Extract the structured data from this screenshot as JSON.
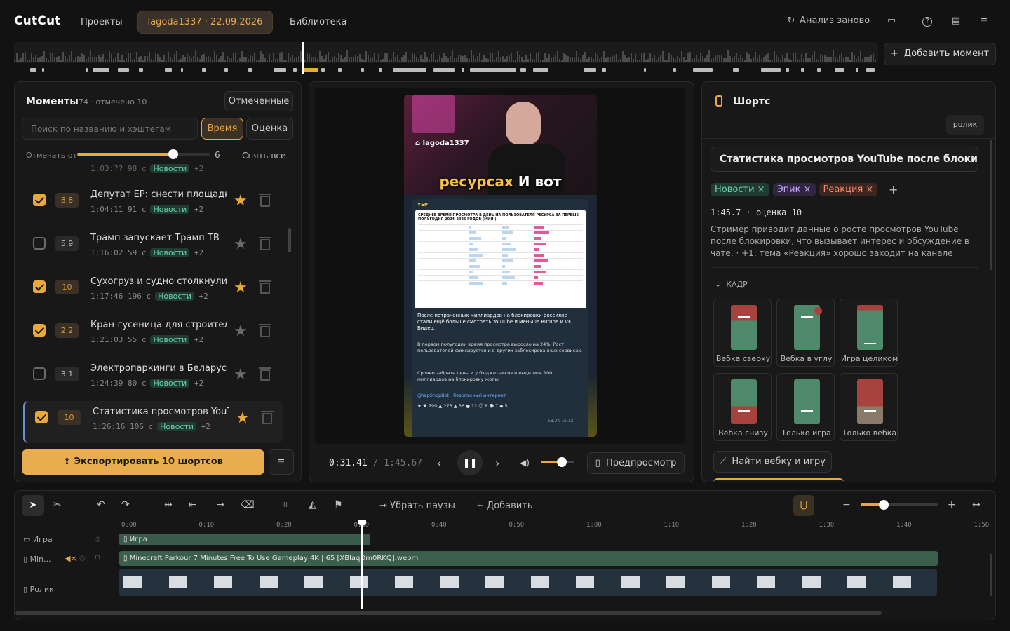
{
  "app": {
    "title": "CutCut"
  },
  "nav": {
    "projects": "Проекты",
    "active_tab": "lagoda1337 · 22.09.2026",
    "library": "Библиотека"
  },
  "toolbar": {
    "reanalyze": "Анализ заново",
    "add_moment": "Добавить момент"
  },
  "moments": {
    "title": "Моменты",
    "count": "74",
    "marked": "отмечено 10",
    "marked_btn": "Отмеченные",
    "search_placeholder": "Поиск по названию и хэштегам",
    "sort_time": "Время",
    "sort_score": "Оценка",
    "mark_from_label": "Отмечать от",
    "mark_from_value": "6",
    "mark_from_level": 0.72,
    "unmark_all": "Снять все",
    "rows": [
      {
        "checked": true,
        "score": "8.8",
        "title": "Депутат ЕР: снести площадку ...",
        "time": "1:04:11",
        "dur": "91 с",
        "tag": "Новости",
        "more": "+2",
        "starred": true
      },
      {
        "checked": false,
        "score": "5.9",
        "title": "Трамп запускает Трамп ТВ",
        "time": "1:16:02",
        "dur": "59 с",
        "tag": "Новости",
        "more": "+2",
        "starred": false
      },
      {
        "checked": true,
        "score": "10",
        "title": "Сухогруз и судно столкнулись...",
        "time": "1:17:46",
        "dur": "196 с",
        "tag": "Новости",
        "more": "+2",
        "starred": true
      },
      {
        "checked": true,
        "score": "2.2",
        "title": "Кран-гусеница для строитель...",
        "time": "1:21:03",
        "dur": "55 с",
        "tag": "Новости",
        "more": "+2",
        "starred": false
      },
      {
        "checked": false,
        "score": "3.1",
        "title": "Электропаркинги в Беларуси ...",
        "time": "1:24:39",
        "dur": "80 с",
        "tag": "Новости",
        "more": "+2",
        "starred": false
      },
      {
        "checked": true,
        "score": "10",
        "title": "Статистика просмотров YouTu...",
        "time": "1:26:16",
        "dur": "106 с",
        "tag": "Новости",
        "more": "+2",
        "starred": true
      }
    ],
    "partial_time": "1:03:??",
    "partial_dur": "98 с",
    "partial_tag": "Новости",
    "partial_more": "+2",
    "export_btn": "Экспортировать 10 шортсов"
  },
  "player": {
    "channel": "lagoda1337",
    "caption_a": "ресурсах",
    "caption_b": "И вот",
    "post_header": "YEP",
    "post_title": "СРЕДНЕЕ ВРЕМЯ ПРОСМОТРА В ДЕНЬ НА ПОЛЬЗОВАТЕЛЯ РЕСУРСА ЗА ПЕРВЫЕ ПОЛУГОДИЯ 2024–2026 ГОДОВ (МИН.)",
    "post_text1": "После потраченных миллиардов на блокировки россияне стали ещё больше смотреть YouTube и меньше Rutube и VK Видео.",
    "post_text2": "В первом полугодии время просмотра выросло на 24%. Рост пользователей фиксируется и в других заблокированных сервисах.",
    "post_text3": "Срочно забрать деньги у бюджетников и выделить 100 миллиардов на блокировку жопы",
    "post_footer": "@YepShopBot · безопасный интернет",
    "post_stats": "18,3K 15:12",
    "time_current": "0:31.41",
    "time_sep": "/",
    "time_total": "1:45.67",
    "volume_level": 0.62,
    "preview_btn": "Предпросмотр"
  },
  "shorts": {
    "title": "Шортс",
    "badge": "ролик",
    "clip_title": "Статистика просмотров YouTube после блокировки",
    "tags": [
      {
        "name": "Новости",
        "color": "#6dd0a6",
        "bg": "#1f3b33"
      },
      {
        "name": "Эпик",
        "color": "#c9a6ff",
        "bg": "#2f2740"
      },
      {
        "name": "Реакция",
        "color": "#f08a6a",
        "bg": "#3d2620"
      }
    ],
    "duration": "1:45.7",
    "score_label": "оценка 10",
    "description": "Стример приводит данные о росте просмотров YouTube после блокировки, что вызывает интерес и обсуждение в чате.  ·  +1: тема «Реакция» хорошо заходит на канале",
    "frame_section": "КАДР",
    "frames": [
      "Вебка сверху",
      "Вебка в углу",
      "Игра целиком",
      "Вебка снизу",
      "Только игра",
      "Только вебка"
    ],
    "find_webcam": "Найти вебку и игру"
  },
  "timeline": {
    "remove_pauses": "Убрать паузы",
    "add": "Добавить",
    "zoom_level": 0.3,
    "ticks": [
      "0:00",
      "0:10",
      "0:20",
      "0:30",
      "0:40",
      "0:50",
      "1:00",
      "1:10",
      "1:20",
      "1:30",
      "1:40",
      "1:50"
    ],
    "tracks": [
      {
        "name": "Игра",
        "clip": "Игра"
      },
      {
        "name": "Min...",
        "clip": "Minecraft Parkour 7 Minutes Free To Use Gameplay 4K  |  65 [XBlaqOm0RKQ].webm"
      },
      {
        "name": "Ролик",
        "clip": ""
      }
    ]
  }
}
